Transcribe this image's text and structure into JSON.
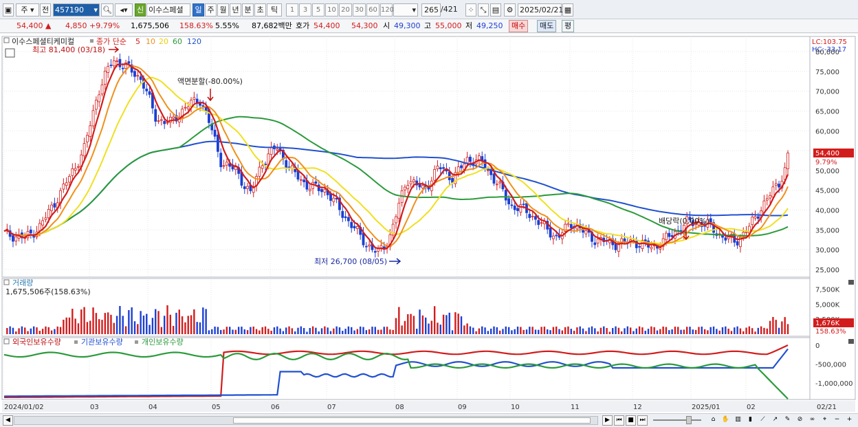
{
  "toolbar": {
    "period_sel": "주",
    "prev_label": "전",
    "code": "457190",
    "name": "이수스페셜",
    "new_badge": "신",
    "periods": [
      "일",
      "주",
      "월",
      "년",
      "분",
      "초",
      "틱"
    ],
    "intervals": [
      "1",
      "3",
      "5",
      "10",
      "20",
      "30",
      "60",
      "120"
    ],
    "count": "265",
    "total": "/421",
    "date": "2025/02/21"
  },
  "info": {
    "price": "54,400",
    "change": "4,850",
    "change_pct": "+9.79%",
    "volume": "1,675,506",
    "volume_pct": "158.63%",
    "turnover_pct": "5.55%",
    "amount": "87,682백만",
    "ask_label": "호가",
    "ask": "54,400",
    "bid": "54,300",
    "open_label": "시",
    "open": "49,300",
    "high_label": "고",
    "high": "55,000",
    "low_label": "저",
    "low": "49,250",
    "buy_label": "매수",
    "sell_label": "매도",
    "eval_label": "평"
  },
  "price_panel": {
    "stock_label": "이수스페셜티케미컬",
    "ma_label": "종가 단순",
    "ma_periods": [
      "5",
      "10",
      "20",
      "60",
      "120"
    ],
    "ma_colors": [
      "#d21c1c",
      "#f0901c",
      "#f0e020",
      "#2a9a3a",
      "#2050d0"
    ],
    "lc": "LC:103.75",
    "hc": "HC:-33.17",
    "y_labels": [
      "80,000",
      "75,000",
      "70,000",
      "65,000",
      "60,000",
      "55,000",
      "50,000",
      "45,000",
      "40,000",
      "35,000",
      "30,000",
      "25,000"
    ],
    "current_price": "54,400",
    "current_pct": "9.79%",
    "max_note": "최고 81,400 (03/18)",
    "min_note": "최저 26,700 (08/05)",
    "split_note": "액면분할(-80.00%)",
    "dividend_note": "배당락(0.00%)"
  },
  "volume_panel": {
    "title": "거래량",
    "value": "1,675,506주(158.63%)",
    "y_labels": [
      "7,500K",
      "5,000K",
      "2,500K"
    ],
    "current": "1,676K",
    "current_pct": "158.63%"
  },
  "holder_panel": {
    "foreign": "외국인보유수량",
    "institution": "기관보유수량",
    "individual": "개인보유수량",
    "y_labels": [
      "0",
      "-500,000",
      "-1,000,000"
    ]
  },
  "x_labels": [
    "2024/01/02",
    "03",
    "04",
    "05",
    "06",
    "07",
    "08",
    "09",
    "10",
    "11",
    "12",
    "2025/01",
    "02",
    "02/21"
  ],
  "colors": {
    "up": "#d21c1c",
    "down": "#1c3fd2",
    "ma5": "#d21c1c",
    "ma10": "#f0901c",
    "ma20": "#f0e020",
    "ma60": "#2a9a3a",
    "ma120": "#2050d0"
  }
}
